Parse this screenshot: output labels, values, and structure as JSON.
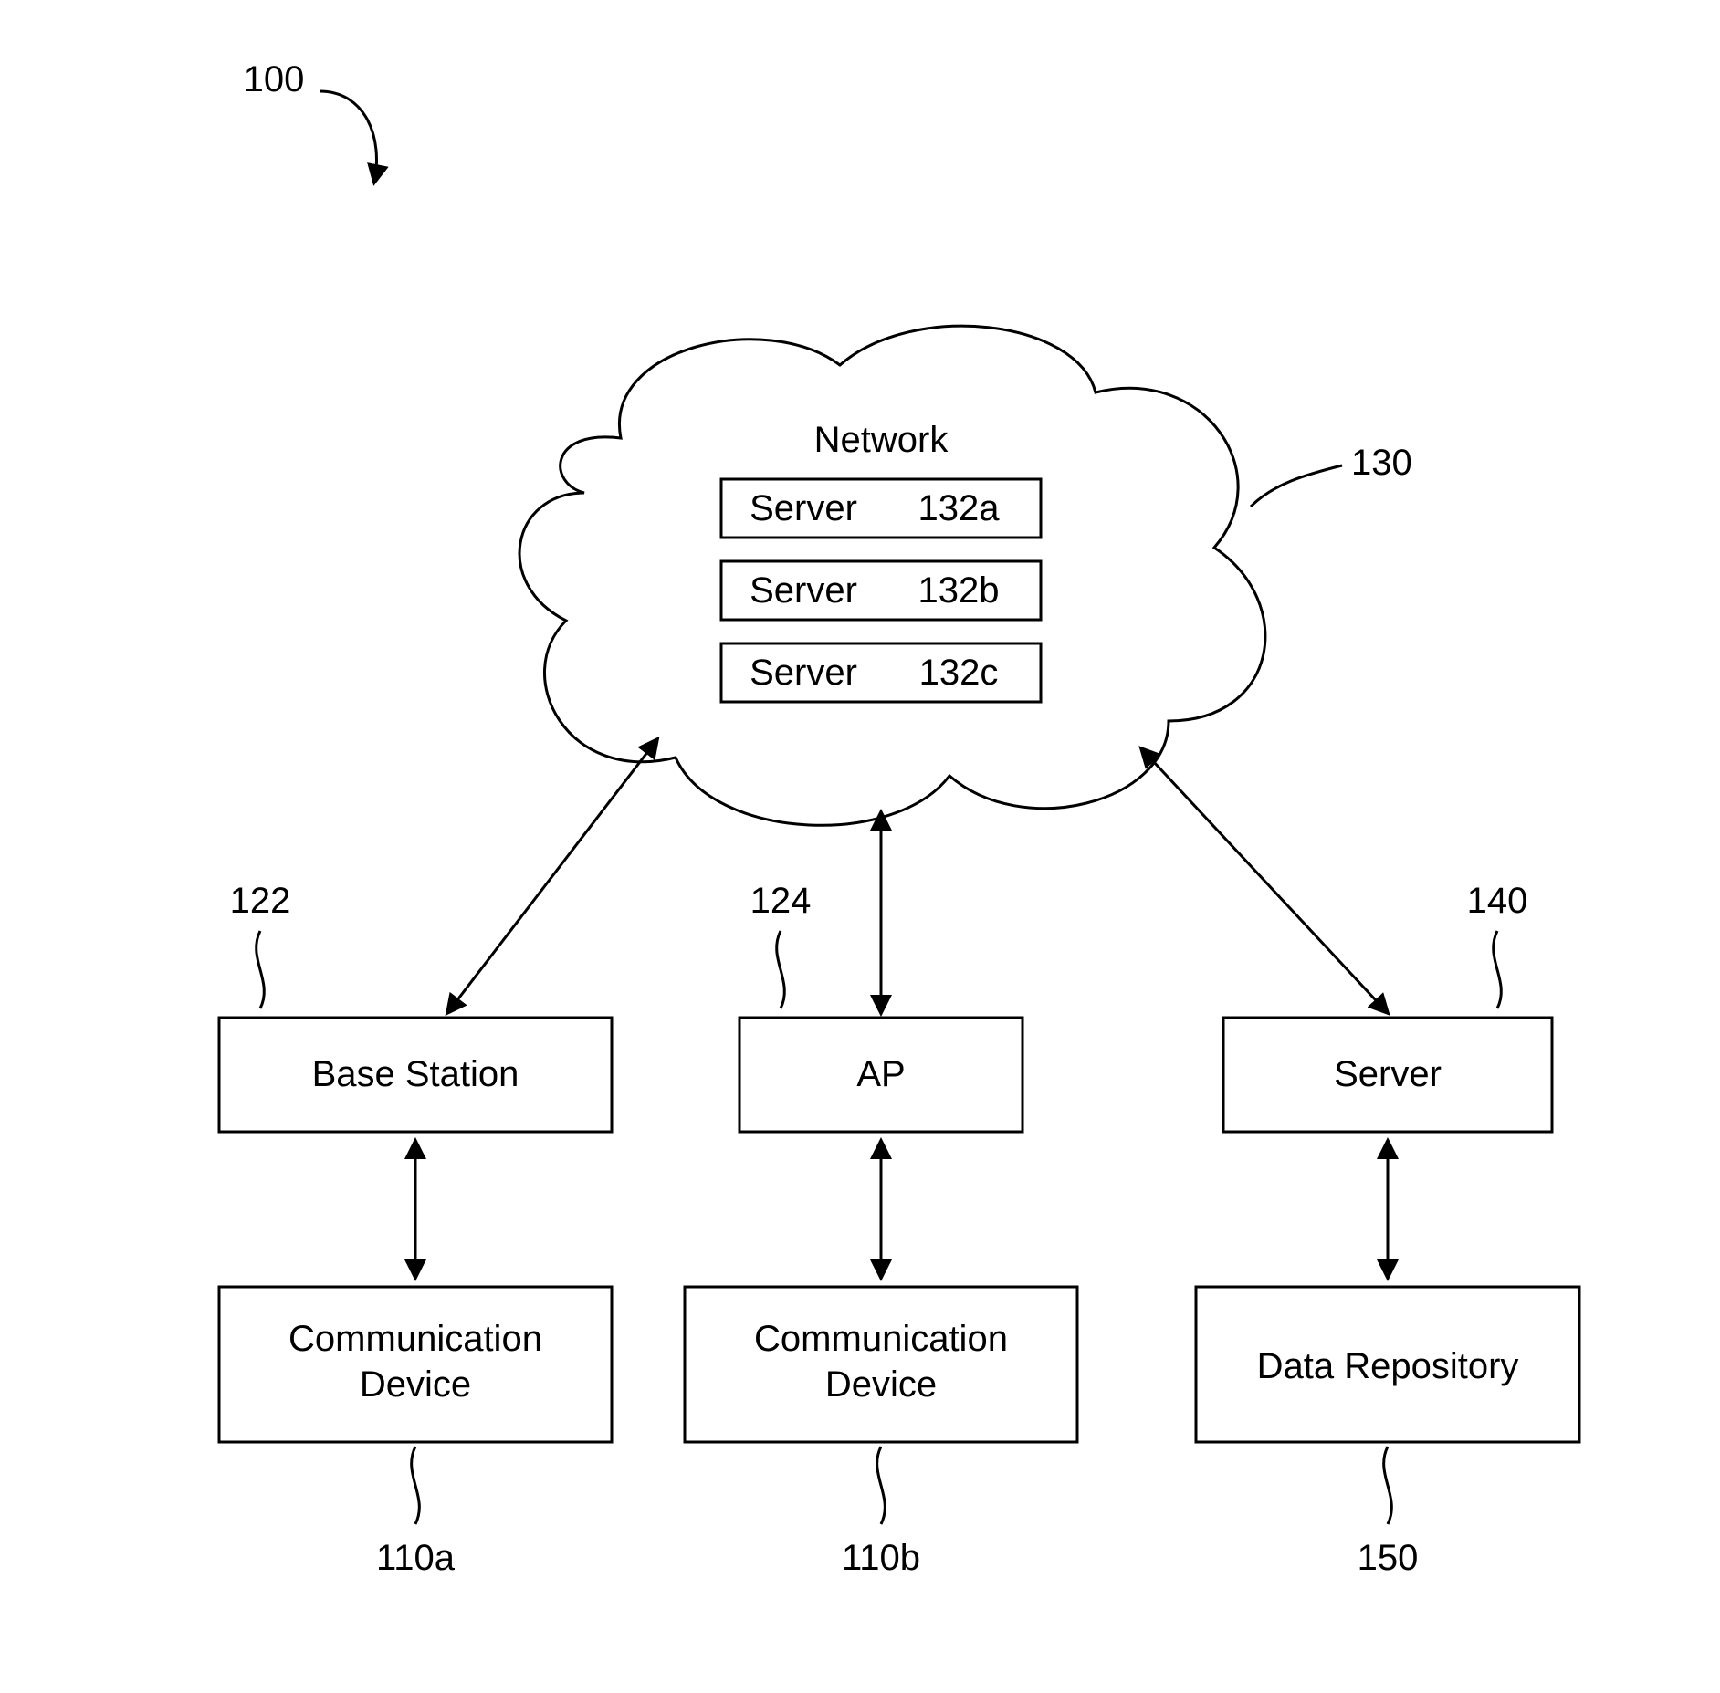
{
  "figure_ref": "100",
  "cloud": {
    "ref": "130",
    "title": "Network",
    "servers": [
      {
        "label": "Server",
        "ref": "132a"
      },
      {
        "label": "Server",
        "ref": "132b"
      },
      {
        "label": "Server",
        "ref": "132c"
      }
    ]
  },
  "row1": {
    "left": {
      "ref": "122",
      "label": "Base Station"
    },
    "center": {
      "ref": "124",
      "label": "AP"
    },
    "right": {
      "ref": "140",
      "label": "Server"
    }
  },
  "row2": {
    "left": {
      "ref": "110a",
      "label": "Communication\nDevice"
    },
    "center": {
      "ref": "110b",
      "label": "Communication\nDevice"
    },
    "right": {
      "ref": "150",
      "label": "Data Repository"
    }
  }
}
